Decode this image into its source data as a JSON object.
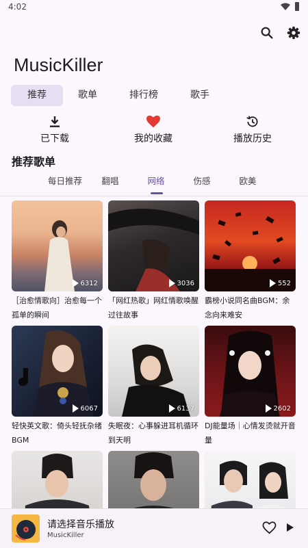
{
  "status": {
    "time": "4:02"
  },
  "app": {
    "title": "MusicKiller"
  },
  "main_tabs": [
    {
      "label": "推荐",
      "active": true
    },
    {
      "label": "歌单",
      "active": false
    },
    {
      "label": "排行榜",
      "active": false
    },
    {
      "label": "歌手",
      "active": false
    }
  ],
  "quick_actions": [
    {
      "label": "已下载",
      "icon": "download-icon"
    },
    {
      "label": "我的收藏",
      "icon": "heart-icon"
    },
    {
      "label": "播放历史",
      "icon": "history-icon"
    }
  ],
  "section": {
    "title": "推荐歌单"
  },
  "sub_tabs": [
    {
      "label": "每日推荐"
    },
    {
      "label": "翻唱"
    },
    {
      "label": "网络",
      "active": true
    },
    {
      "label": "伤感"
    },
    {
      "label": "欧美"
    }
  ],
  "playlists": [
    {
      "title": "［治愈情歌向］治愈每一个孤单的瞬间",
      "count": "6312"
    },
    {
      "title": "「网红热歌」网红情歌唤醒过往故事",
      "count": "3036"
    },
    {
      "title": "霸榜小说同名曲BGM：余念向来难安",
      "count": "552"
    },
    {
      "title": "轻快英文歌：倚头轻抚杂绪BGM",
      "count": "6067"
    },
    {
      "title": "失眠夜：心事躲进耳机循环到天明",
      "count": "6137"
    },
    {
      "title": "DJ能量场｜心情发烫就开音量",
      "count": "2602"
    },
    {
      "title": "",
      "count": ""
    },
    {
      "title": "",
      "count": ""
    },
    {
      "title": "",
      "count": ""
    }
  ],
  "player": {
    "title": "请选择音乐播放",
    "subtitle": "MusicKiller"
  },
  "colors": {
    "accent": "#6750a4",
    "heart": "#e53935",
    "tab_active_bg": "#e6dff3",
    "background": "#fbf7fc"
  }
}
